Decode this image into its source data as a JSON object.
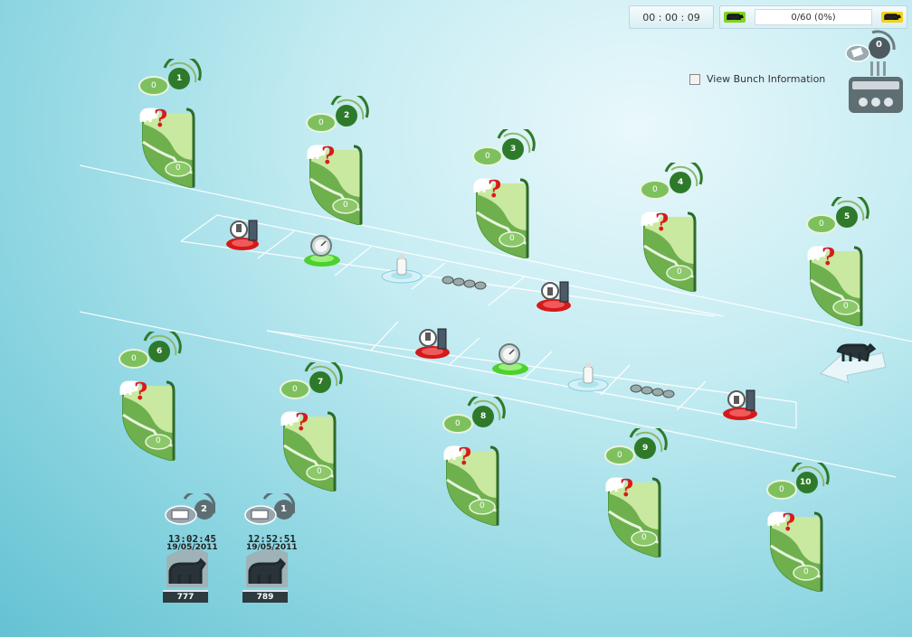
{
  "status": {
    "elapsed_time": "00 : 00 : 09",
    "progress_text": "0/60 (0%)",
    "progress_fraction": 0
  },
  "options": {
    "view_bunch_label": "View Bunch Information",
    "view_bunch_checked": false
  },
  "conditioner": {
    "count": "0"
  },
  "pens": [
    {
      "number": "1",
      "badge_value": "0",
      "pen_value": "0"
    },
    {
      "number": "2",
      "badge_value": "0",
      "pen_value": "0"
    },
    {
      "number": "3",
      "badge_value": "0",
      "pen_value": "0"
    },
    {
      "number": "4",
      "badge_value": "0",
      "pen_value": "0"
    },
    {
      "number": "5",
      "badge_value": "0",
      "pen_value": "0"
    },
    {
      "number": "6",
      "badge_value": "0",
      "pen_value": "0"
    },
    {
      "number": "7",
      "badge_value": "0",
      "pen_value": "0"
    },
    {
      "number": "8",
      "badge_value": "0",
      "pen_value": "0"
    },
    {
      "number": "9",
      "badge_value": "0",
      "pen_value": "0"
    },
    {
      "number": "10",
      "badge_value": "0",
      "pen_value": "0"
    }
  ],
  "dispensers": [
    {
      "tag": "2",
      "time": "13:02:45",
      "date": "19/05/2011",
      "id": "777"
    },
    {
      "tag": "1",
      "time": "12:52:51",
      "date": "19/05/2011",
      "id": "789"
    }
  ],
  "rows": [
    {
      "stations": [
        "unload-station",
        "scale-station",
        "milk-station",
        "roller-station",
        "load-station"
      ]
    },
    {
      "stations": [
        "unload-station",
        "scale-station",
        "milk-station",
        "roller-station",
        "load-station"
      ]
    }
  ],
  "colors": {
    "accent_green": "#2f7a2a",
    "pen_light": "#c9e8a0",
    "pen_dark": "#4f9a3e",
    "alert_red": "#d91a1a",
    "station_red": "#d41a1a"
  },
  "icon_names": {
    "pen_icon": "cow-pen-icon",
    "question": "question-mark-icon",
    "cow": "cow-icon",
    "arrow": "entry-arrow-icon"
  }
}
